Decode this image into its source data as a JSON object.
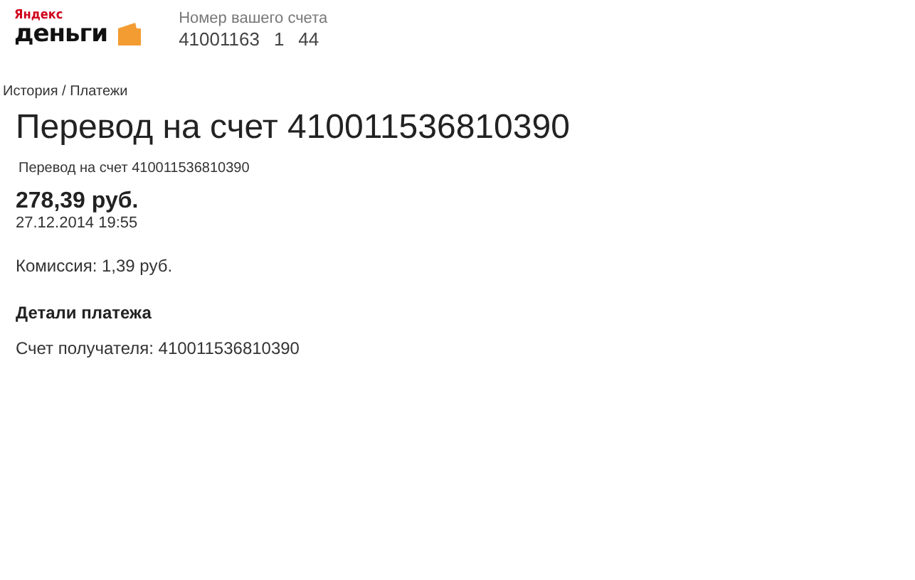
{
  "logo": {
    "brand": "Яндекс",
    "product": "деньги"
  },
  "account": {
    "label": "Номер вашего счета",
    "number_parts": [
      "41001163",
      "1",
      "44"
    ]
  },
  "breadcrumb": "История / Платежи",
  "payment": {
    "title": "Перевод на счет 410011536810390",
    "description": "Перевод на счет 410011536810390",
    "amount": "278,39 руб.",
    "date": "27.12.2014 19:55",
    "commission": "Комиссия: 1,39 руб."
  },
  "details": {
    "heading": "Детали платежа",
    "recipient": "Счет получателя: 410011536810390"
  }
}
